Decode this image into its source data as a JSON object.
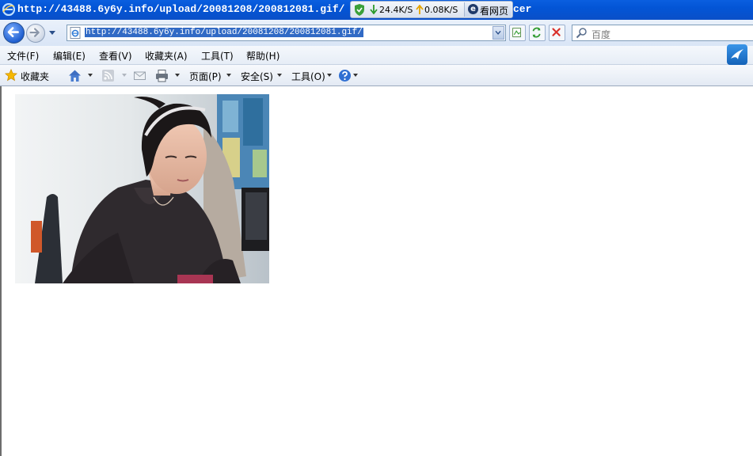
{
  "title_bar": {
    "title": "http://43488.6y6y.info/upload/20081208/200812081.gif/",
    "title_tail": "cer",
    "download_speed": "24.4K/S",
    "upload_speed": "0.08K/S",
    "view_button_label": "看网页"
  },
  "address_bar": {
    "url": "http://43488.6y6y.info/upload/20081208/200812081.gif/",
    "search_placeholder": "百度"
  },
  "menu": {
    "items": [
      "文件(F)",
      "编辑(E)",
      "查看(V)",
      "收藏夹(A)",
      "工具(T)",
      "帮助(H)"
    ]
  },
  "command_bar": {
    "favorites_label": "收藏夹",
    "page_label": "页面(P)",
    "safety_label": "安全(S)",
    "tools_label": "工具(O)"
  },
  "icons": {
    "title": "ie-icon",
    "speed": "shield-icon",
    "nav": [
      "back-arrow-icon",
      "forward-arrow-icon"
    ],
    "command": [
      "star-icon",
      "home-icon",
      "rss-icon",
      "mail-icon",
      "printer-icon",
      "help-icon"
    ],
    "brand": "bird-logo"
  },
  "colors": {
    "title_bar": "#0355d6",
    "selection": "#316ac5",
    "stop": "#d9302a"
  }
}
